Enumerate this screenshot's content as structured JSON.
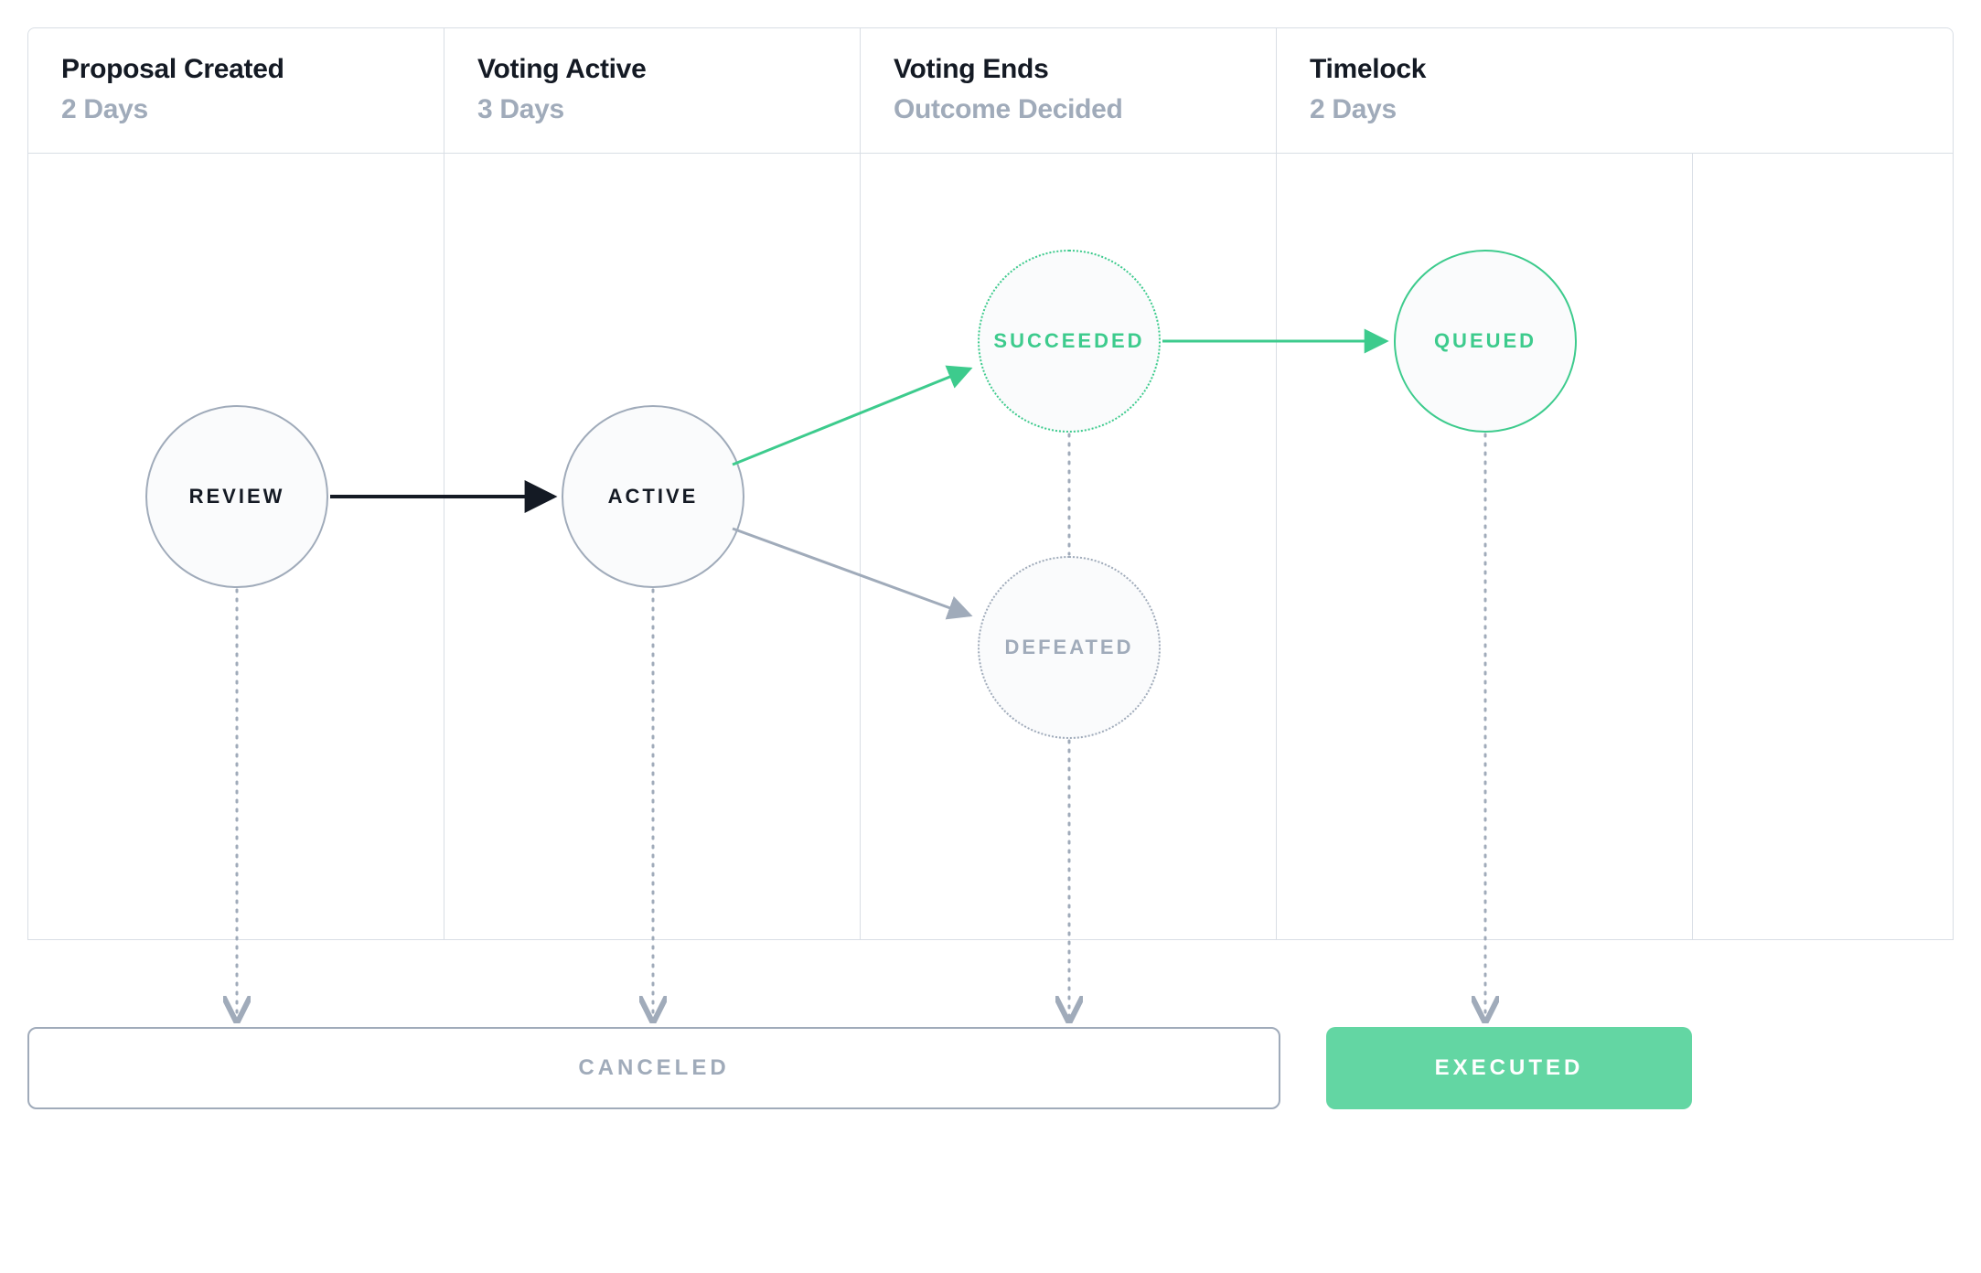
{
  "columns": [
    {
      "title": "Proposal Created",
      "sub": "2 Days"
    },
    {
      "title": "Voting Active",
      "sub": "3 Days"
    },
    {
      "title": "Voting Ends",
      "sub": "Outcome Decided"
    },
    {
      "title": "Timelock",
      "sub": "2 Days"
    }
  ],
  "states": {
    "review": "REVIEW",
    "active": "ACTIVE",
    "succeeded": "SUCCEEDED",
    "defeated": "DEFEATED",
    "queued": "QUEUED"
  },
  "terminals": {
    "canceled": "CANCELED",
    "executed": "EXECUTED"
  },
  "colors": {
    "grey_border": "#D9DEE5",
    "grey_muted": "#A0ABBA",
    "grey_text": "#141A24",
    "green": "#3DCB8D",
    "green_soft": "#63D6A3"
  },
  "edges": [
    {
      "from": "review",
      "to": "active",
      "style": "solid",
      "color": "black"
    },
    {
      "from": "active",
      "to": "succeeded",
      "style": "solid",
      "color": "green"
    },
    {
      "from": "active",
      "to": "defeated",
      "style": "solid",
      "color": "grey"
    },
    {
      "from": "succeeded",
      "to": "queued",
      "style": "solid",
      "color": "green"
    },
    {
      "from": "review",
      "to": "canceled",
      "style": "dotted",
      "color": "grey"
    },
    {
      "from": "active",
      "to": "canceled",
      "style": "dotted",
      "color": "grey"
    },
    {
      "from": "succeeded",
      "to": "defeated",
      "style": "dotted",
      "color": "grey"
    },
    {
      "from": "defeated",
      "to": "canceled",
      "style": "dotted",
      "color": "grey"
    },
    {
      "from": "queued",
      "to": "executed",
      "style": "dotted",
      "color": "grey"
    }
  ]
}
